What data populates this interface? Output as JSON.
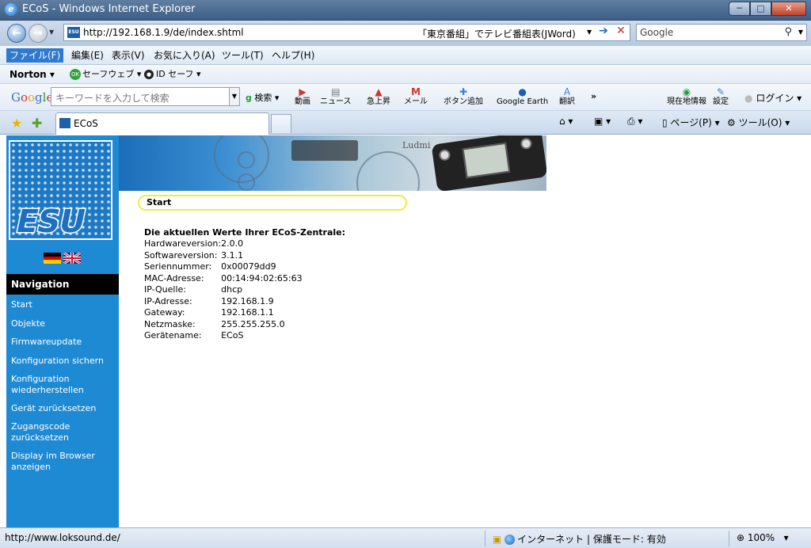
{
  "window": {
    "title": "ECoS - Windows Internet Explorer",
    "minimize": "─",
    "maximize": "□",
    "close": "✕"
  },
  "address": {
    "url": "http://192.168.1.9/de/index.shtml",
    "jword": "「東京番組」でテレビ番組表(JWord)",
    "search_placeholder": "Google"
  },
  "menu": {
    "items": [
      "ファイル(F)",
      "編集(E)",
      "表示(V)",
      "お気に入り(A)",
      "ツール(T)",
      "ヘルプ(H)"
    ]
  },
  "norton": {
    "brand": "Norton",
    "safeweb": "セーフウェブ",
    "idsafe": "ID セーフ"
  },
  "google_bar": {
    "logo": [
      "G",
      "o",
      "o",
      "g",
      "l",
      "e"
    ],
    "input_placeholder": "キーワードを入力して検索",
    "search_label": "検索",
    "buttons": [
      "動画",
      "ニュース",
      "急上昇",
      "メール",
      "ボタン追加",
      "Google Earth",
      "翻訳",
      "現在地情報",
      "設定"
    ],
    "login": "ログイン",
    "more": "»"
  },
  "tabs": {
    "active_label": "ECoS"
  },
  "command_bar": {
    "page": "ページ(P)",
    "tools": "ツール(O)"
  },
  "sidebar": {
    "logo_text": "ESU",
    "nav_heading": "Navigation",
    "links": [
      "Start",
      "Objekte",
      "Firmwareupdate",
      "Konfiguration sichern",
      "Konfiguration wiederherstellen",
      "Gerät zurücksetzen",
      "Zugangscode zurücksetzen",
      "Display im Browser anzeigen"
    ]
  },
  "banner": {
    "text": "Ludmi"
  },
  "content": {
    "section_title": "Start",
    "info_heading": "Die aktuellen Werte Ihrer ECoS-Zentrale:",
    "rows": [
      {
        "key": "Hardwareversion:",
        "value": "2.0.0"
      },
      {
        "key": "Softwareversion:",
        "value": "3.1.1"
      },
      {
        "key": "Seriennummer:",
        "value": "0x00079dd9"
      },
      {
        "key": "MAC-Adresse:",
        "value": "00:14:94:02:65:63"
      },
      {
        "key": "IP-Quelle:",
        "value": "dhcp"
      },
      {
        "key": "IP-Adresse:",
        "value": "192.168.1.9"
      },
      {
        "key": "Gateway:",
        "value": "192.168.1.1"
      },
      {
        "key": "Netzmaske:",
        "value": "255.255.255.0"
      },
      {
        "key": "Gerätename:",
        "value": "ECoS"
      }
    ]
  },
  "status": {
    "url": "http://www.loksound.de/",
    "zone": "インターネット | 保護モード: 有効",
    "zoom": "100%"
  },
  "colors": {
    "sidebar": "#1f8ad4",
    "start_border": "#f2ea48",
    "nav_head": "#000000"
  }
}
